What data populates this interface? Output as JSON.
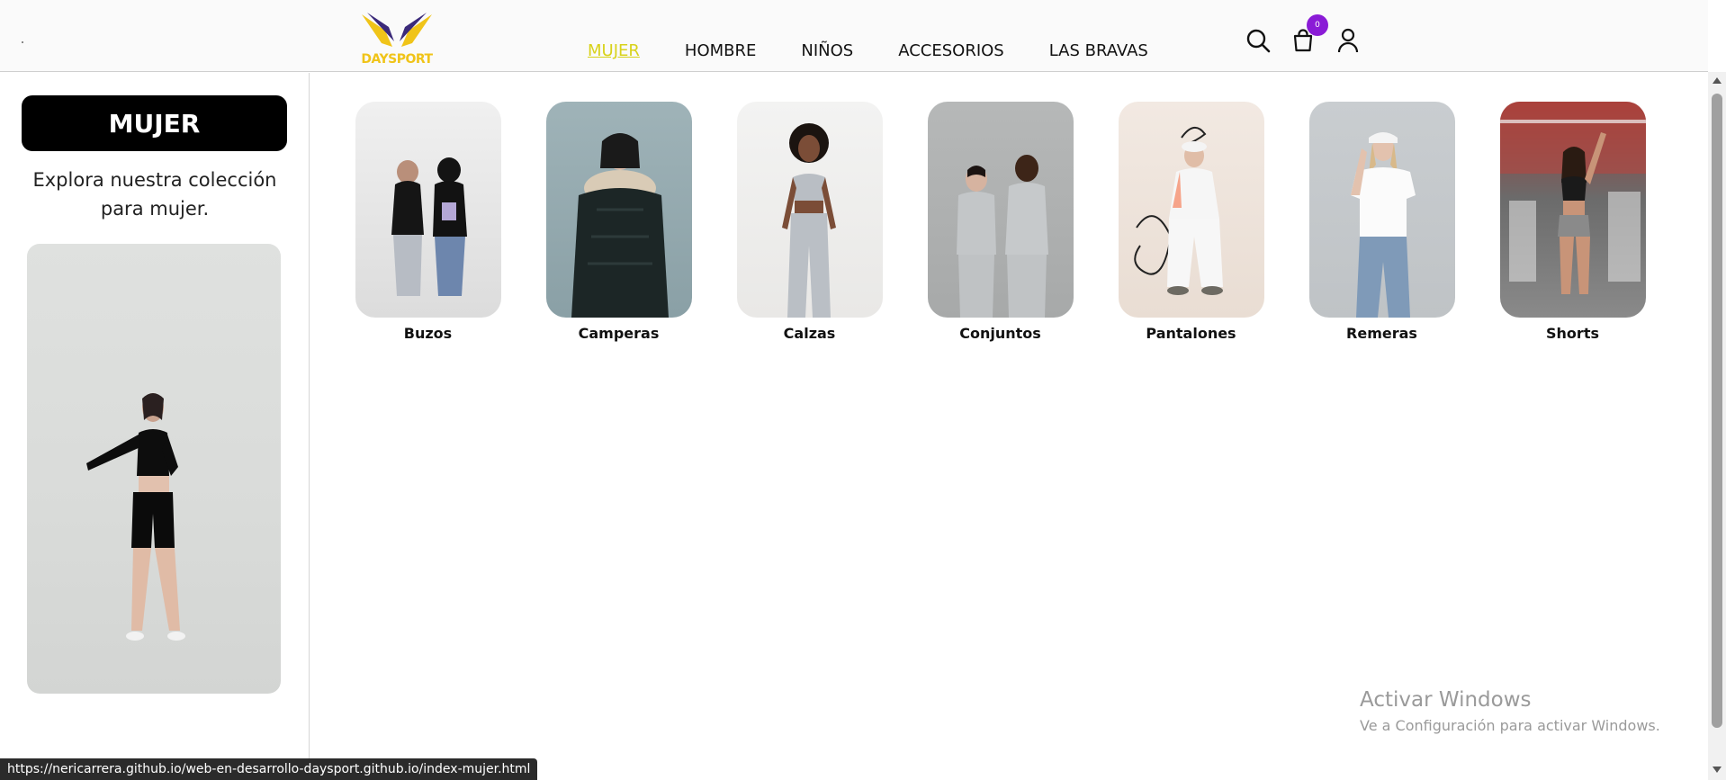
{
  "header": {
    "logo_text": "DAYSPORT",
    "nav": [
      {
        "label": "MUJER",
        "active": true
      },
      {
        "label": "HOMBRE",
        "active": false
      },
      {
        "label": "NIÑOS",
        "active": false
      },
      {
        "label": "ACCESORIOS",
        "active": false
      },
      {
        "label": "LAS BRAVAS",
        "active": false
      }
    ],
    "cart_count": "0",
    "icons": [
      "search-icon",
      "cart-icon",
      "user-icon"
    ]
  },
  "sidebar": {
    "title": "MUJER",
    "description": "Explora nuestra colección para mujer."
  },
  "categories": [
    {
      "label": "Buzos"
    },
    {
      "label": "Camperas"
    },
    {
      "label": "Calzas"
    },
    {
      "label": "Conjuntos"
    },
    {
      "label": "Pantalones"
    },
    {
      "label": "Remeras"
    },
    {
      "label": "Shorts"
    }
  ],
  "watermark": {
    "title": "Activar Windows",
    "subtitle": "Ve a Configuración para activar Windows."
  },
  "status_url": "https://nericarrera.github.io/web-en-desarrollo-daysport.github.io/index-mujer.html",
  "colors": {
    "accent": "#d8d21a",
    "badge": "#8a1bd6",
    "logo_gold": "#f0c419",
    "logo_purple": "#3b2a7a"
  }
}
